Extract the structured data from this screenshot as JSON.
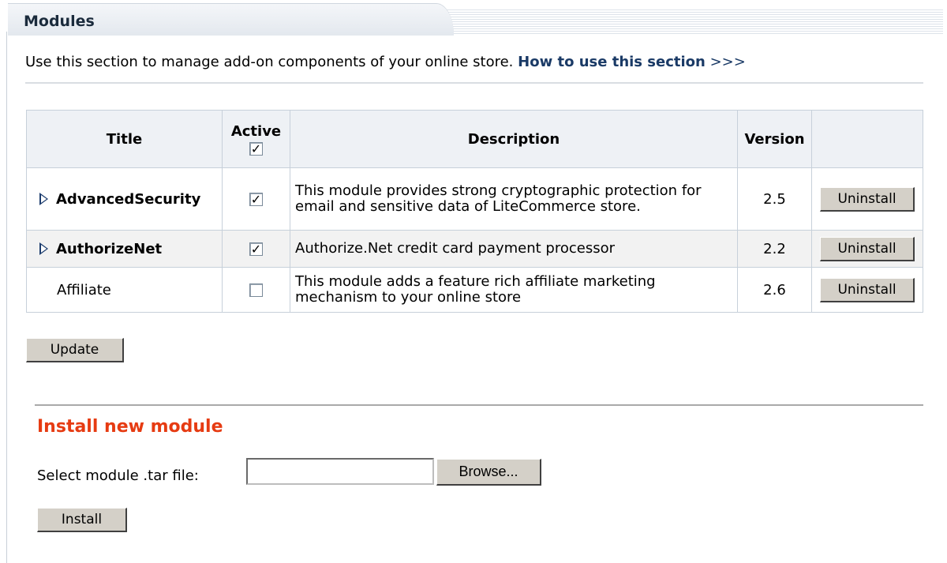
{
  "header": {
    "title": "Modules"
  },
  "intro": {
    "text": "Use this section to manage add-on components of your online store.",
    "help_link": "How to use this section",
    "help_arrows": ">>>"
  },
  "table": {
    "columns": {
      "title": "Title",
      "active": "Active",
      "description": "Description",
      "version": "Version"
    },
    "header_active_checked": true,
    "rows": [
      {
        "title": "AdvancedSecurity",
        "has_expander": true,
        "active": true,
        "description": "This module provides strong cryptographic protection for email and sensitive data of LiteCommerce store.",
        "version": "2.5",
        "action": "Uninstall"
      },
      {
        "title": "AuthorizeNet",
        "has_expander": true,
        "active": true,
        "description": "Authorize.Net credit card payment processor",
        "version": "2.2",
        "action": "Uninstall"
      },
      {
        "title": "Affiliate",
        "has_expander": false,
        "active": false,
        "description": "This module adds a feature rich affiliate marketing mechanism to your online store",
        "version": "2.6",
        "action": "Uninstall"
      }
    ]
  },
  "update_button": "Update",
  "install": {
    "heading": "Install new module",
    "file_label": "Select module .tar file:",
    "file_value": "",
    "browse_button": "Browse...",
    "install_button": "Install"
  },
  "colors": {
    "accent_heading": "#e63b12",
    "link": "#1a3a66",
    "table_border": "#c7d0da",
    "button_face": "#d4d0c8"
  },
  "icons": {
    "expander": "triangle-right-icon",
    "checkbox_checked": "checkmark-icon"
  }
}
